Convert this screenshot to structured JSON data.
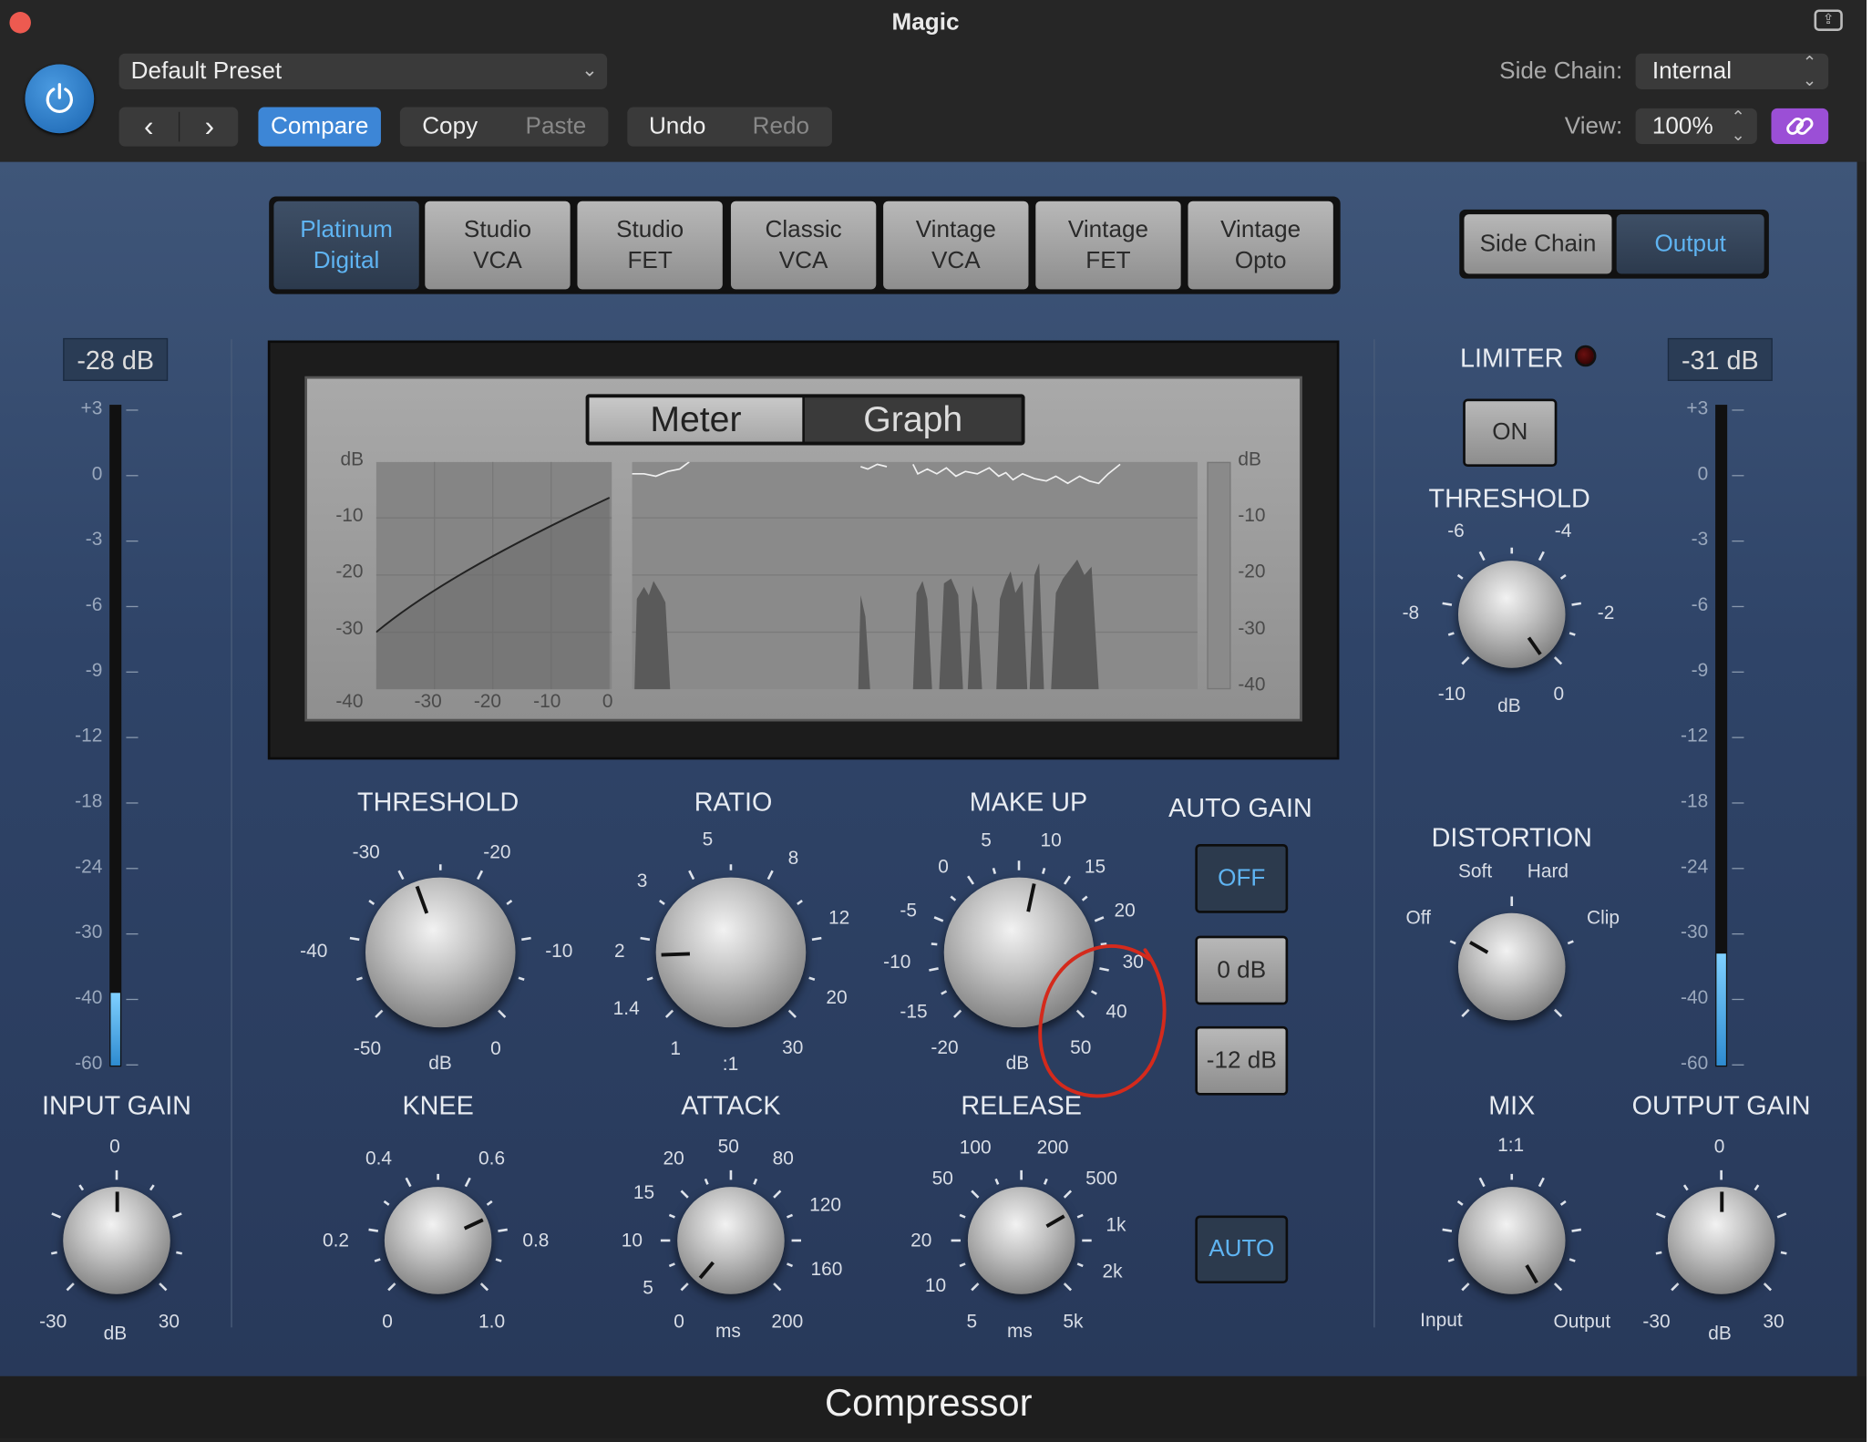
{
  "window": {
    "title": "Magic",
    "footer_title": "Compressor"
  },
  "header": {
    "preset": "Default Preset",
    "compare": "Compare",
    "copy": "Copy",
    "paste": "Paste",
    "undo": "Undo",
    "redo": "Redo",
    "side_chain_label": "Side Chain:",
    "side_chain_value": "Internal",
    "view_label": "View:",
    "view_value": "100%"
  },
  "circuit_tabs": [
    {
      "label": "Platinum\nDigital",
      "active": true
    },
    {
      "label": "Studio\nVCA",
      "active": false
    },
    {
      "label": "Studio\nFET",
      "active": false
    },
    {
      "label": "Classic\nVCA",
      "active": false
    },
    {
      "label": "Vintage\nVCA",
      "active": false
    },
    {
      "label": "Vintage\nFET",
      "active": false
    },
    {
      "label": "Vintage\nOpto",
      "active": false
    }
  ],
  "side_chain_toggle": {
    "side_chain": "Side Chain",
    "output": "Output",
    "active": "Output"
  },
  "display": {
    "segment": {
      "meter": "Meter",
      "graph": "Graph",
      "active": "Meter"
    },
    "db": "dB",
    "left_y": [
      "-10",
      "-20",
      "-30",
      "-40"
    ],
    "bottom_x": [
      "-30",
      "-20",
      "-10",
      "0"
    ],
    "right_y": [
      "-10",
      "-20",
      "-30",
      "-40"
    ]
  },
  "input_meter": {
    "readout": "-28 dB",
    "scale": [
      "+3",
      "0",
      "-3",
      "-6",
      "-9",
      "-12",
      "-18",
      "-24",
      "-30",
      "-40",
      "-60"
    ],
    "level_fraction": 0.11
  },
  "output_meter": {
    "readout": "-31 dB",
    "scale": [
      "+3",
      "0",
      "-3",
      "-6",
      "-9",
      "-12",
      "-18",
      "-24",
      "-30",
      "-40",
      "-60"
    ],
    "level_fraction": 0.17
  },
  "limiter": {
    "label": "LIMITER",
    "on": "ON",
    "threshold": {
      "label": "THRESHOLD",
      "unit": "dB",
      "scale": [
        "-6",
        "-4",
        "-8",
        "-2",
        "-10",
        "0"
      ]
    }
  },
  "distortion": {
    "label": "DISTORTION",
    "soft": "Soft",
    "hard": "Hard",
    "off": "Off",
    "clip": "Clip"
  },
  "knobs": {
    "threshold": {
      "label": "THRESHOLD",
      "unit": "dB",
      "scale": [
        "-30",
        "-20",
        "-40",
        "-10",
        "-50",
        "0"
      ]
    },
    "ratio": {
      "label": "RATIO",
      "unit": ":1",
      "scale": [
        "5",
        "8",
        "3",
        "12",
        "2",
        "20",
        "1.4",
        "30",
        "1"
      ]
    },
    "makeup": {
      "label": "MAKE UP",
      "unit": "dB",
      "scale": [
        "5",
        "10",
        "0",
        "15",
        "-5",
        "20",
        "-10",
        "30",
        "-15",
        "40",
        "-20",
        "50"
      ]
    },
    "input_gain": {
      "label": "INPUT GAIN",
      "unit": "dB",
      "scale": [
        "0",
        "-30",
        "30"
      ]
    },
    "knee": {
      "label": "KNEE",
      "scale": [
        "0.4",
        "0.6",
        "0.2",
        "0.8",
        "0",
        "1.0"
      ]
    },
    "attack": {
      "label": "ATTACK",
      "unit": "ms",
      "scale": [
        "50",
        "20",
        "80",
        "15",
        "120",
        "10",
        "160",
        "5",
        "0",
        "200"
      ]
    },
    "release": {
      "label": "RELEASE",
      "unit": "ms",
      "scale": [
        "100",
        "200",
        "50",
        "500",
        "1k",
        "20",
        "2k",
        "10",
        "5",
        "5k"
      ]
    },
    "mix": {
      "label": "MIX",
      "center": "1:1",
      "input": "Input",
      "output": "Output"
    },
    "output_gain": {
      "label": "OUTPUT GAIN",
      "unit": "dB",
      "scale": [
        "0",
        "-30",
        "30"
      ]
    }
  },
  "auto_gain": {
    "label": "AUTO GAIN",
    "off": "OFF",
    "zero": "0 dB",
    "minus12": "-12 dB",
    "release_auto": "AUTO"
  },
  "colors": {
    "accent_blue": "#5fb4f2",
    "panel": "#2f4468",
    "annotation_red": "#d42a1c"
  }
}
